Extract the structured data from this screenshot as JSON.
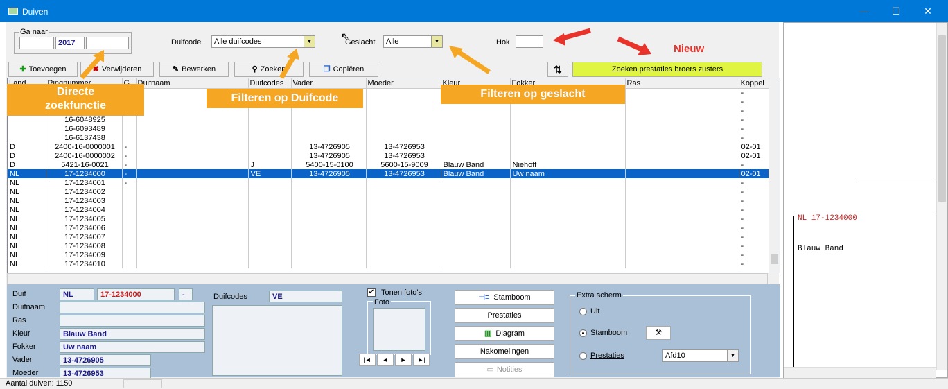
{
  "window": {
    "title": "Duiven"
  },
  "filters": {
    "ga_naar_legend": "Ga naar",
    "year": "2017",
    "duifcode_label": "Duifcode",
    "duifcode_value": "Alle duifcodes",
    "geslacht_label": "Geslacht",
    "geslacht_value": "Alle",
    "hok_label": "Hok"
  },
  "annotations": {
    "nieuw": "Nieuw",
    "directe_line1": "Directe",
    "directe_line2": "zoekfunctie",
    "duifcode": "Filteren op Duifcode",
    "geslacht": "Filteren op geslacht"
  },
  "toolbar": {
    "toevoegen": "Toevoegen",
    "verwijderen": "Verwijderen",
    "bewerken": "Bewerken",
    "zoeken": "Zoeken",
    "copieren": "Copiëren",
    "sort": "⇅",
    "zoeken_prestaties": "Zoeken prestaties broers zusters"
  },
  "grid": {
    "columns": [
      "Land",
      "Ringnummer",
      "G",
      "Duifnaam",
      "Duifcodes",
      "Vader",
      "Moeder",
      "Kleur",
      "Fokker",
      "Ras",
      "Koppel"
    ],
    "rows": [
      [
        "",
        "",
        "",
        "",
        "",
        "",
        "",
        "",
        "",
        "",
        "-"
      ],
      [
        "",
        "",
        "",
        "",
        "",
        "",
        "",
        "",
        "",
        "",
        "-"
      ],
      [
        "",
        "",
        "",
        "",
        "",
        "",
        "",
        "",
        "",
        "",
        "-"
      ],
      [
        "",
        "16-6048925",
        "",
        "",
        "",
        "",
        "",
        "",
        "",
        "",
        "-"
      ],
      [
        "",
        "16-6093489",
        "",
        "",
        "",
        "",
        "",
        "",
        "",
        "",
        "-"
      ],
      [
        "",
        "16-6137438",
        "",
        "",
        "",
        "",
        "",
        "",
        "",
        "",
        "-"
      ],
      [
        "D",
        "2400-16-0000001",
        "-",
        "",
        "",
        "13-4726905",
        "13-4726953",
        "",
        "",
        "",
        "02-01"
      ],
      [
        "D",
        "2400-16-0000002",
        "-",
        "",
        "",
        "13-4726905",
        "13-4726953",
        "",
        "",
        "",
        "02-01"
      ],
      [
        "D",
        "5421-16-0021",
        "-",
        "",
        "J",
        "5400-15-0100",
        "5600-15-9009",
        "Blauw Band",
        "Niehoff",
        "",
        "-"
      ],
      [
        "NL",
        "17-1234000",
        "-",
        "",
        "VE",
        "13-4726905",
        "13-4726953",
        "Blauw Band",
        "Uw naam",
        "",
        "02-01"
      ],
      [
        "NL",
        "17-1234001",
        "-",
        "",
        "",
        "",
        "",
        "",
        "",
        "",
        "-"
      ],
      [
        "NL",
        "17-1234002",
        "",
        "",
        "",
        "",
        "",
        "",
        "",
        "",
        "-"
      ],
      [
        "NL",
        "17-1234003",
        "",
        "",
        "",
        "",
        "",
        "",
        "",
        "",
        "-"
      ],
      [
        "NL",
        "17-1234004",
        "",
        "",
        "",
        "",
        "",
        "",
        "",
        "",
        "-"
      ],
      [
        "NL",
        "17-1234005",
        "",
        "",
        "",
        "",
        "",
        "",
        "",
        "",
        "-"
      ],
      [
        "NL",
        "17-1234006",
        "",
        "",
        "",
        "",
        "",
        "",
        "",
        "",
        "-"
      ],
      [
        "NL",
        "17-1234007",
        "",
        "",
        "",
        "",
        "",
        "",
        "",
        "",
        "-"
      ],
      [
        "NL",
        "17-1234008",
        "",
        "",
        "",
        "",
        "",
        "",
        "",
        "",
        "-"
      ],
      [
        "NL",
        "17-1234009",
        "",
        "",
        "",
        "",
        "",
        "",
        "",
        "",
        "-"
      ],
      [
        "NL",
        "17-1234010",
        "",
        "",
        "",
        "",
        "",
        "",
        "",
        "",
        "-"
      ]
    ],
    "selected_row": 9
  },
  "detail": {
    "duif_label": "Duif",
    "land": "NL",
    "ring": "17-1234000",
    "g": "-",
    "duifnaam_label": "Duifnaam",
    "ras_label": "Ras",
    "kleur_label": "Kleur",
    "kleur": "Blauw Band",
    "fokker_label": "Fokker",
    "fokker": "Uw naam",
    "vader_label": "Vader",
    "vader": "13-4726905",
    "moeder_label": "Moeder",
    "moeder": "13-4726953",
    "duifcodes_label": "Duifcodes",
    "duifcodes": "VE",
    "tonen_fotos": "Tonen foto's",
    "foto_label": "Foto",
    "stamboom": "Stamboom",
    "prestaties": "Prestaties",
    "diagram": "Diagram",
    "nakomelingen": "Nakomelingen",
    "notities": "Notities",
    "extra_scherm": "Extra scherm",
    "opt_uit": "Uit",
    "opt_stamboom": "Stamboom",
    "opt_prestaties": "Prestaties",
    "prestaties_combo": "Afd10",
    "nav_first": "|◄",
    "nav_prev": "◄",
    "nav_next": "►",
    "nav_last": "►|"
  },
  "status": {
    "aantal": "Aantal duiven: 1150"
  },
  "pedigree": {
    "ring": "NL  17-1234000",
    "kleur": "Blauw Band"
  },
  "colors": {
    "titlebar": "#0078d7",
    "selection": "#0a64c8",
    "annotation": "#f5a623",
    "detail_bg": "#aac0d6",
    "nieuw": "#e8322a"
  }
}
